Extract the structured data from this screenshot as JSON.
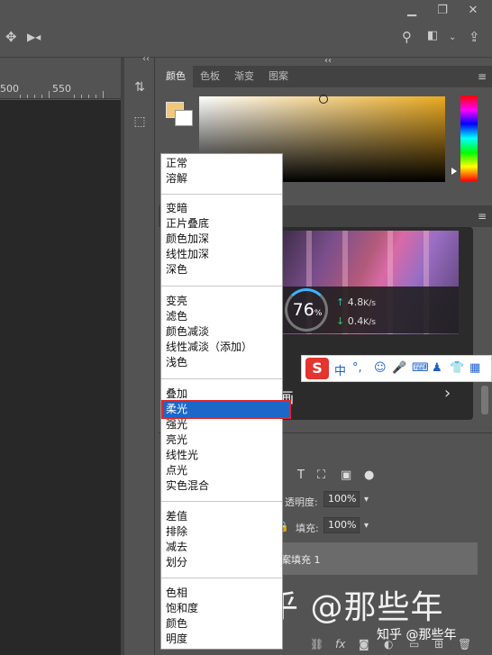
{
  "window": {
    "minimize_icon": "minimize-icon",
    "restore_icon": "restore-icon",
    "close_icon": "close-icon"
  },
  "ruler": {
    "labels": [
      "500",
      "550"
    ]
  },
  "panels": {
    "color_tabs": [
      "颜色",
      "色板",
      "渐变",
      "图案"
    ],
    "active_tab": "颜色",
    "foreground_color": "#f0c87a",
    "background_color": "#ffffff",
    "hue_color": "#ebab21"
  },
  "speed_widget": {
    "percent": "76",
    "percent_unit": "%",
    "upload": "4.8",
    "upload_unit": "K/s",
    "download": "0.4",
    "download_unit": "K/s"
  },
  "ime_toolbar": {
    "logo": "S",
    "mode": "中"
  },
  "card": {
    "title_fragment": "画"
  },
  "layers": {
    "opacity_label": "透明度:",
    "opacity_value": "100%",
    "fill_label": "填充:",
    "fill_value": "100%",
    "layer_name": "案填充 1",
    "fx_label": "fx"
  },
  "blend_menu": {
    "groups": [
      [
        "正常",
        "溶解"
      ],
      [
        "变暗",
        "正片叠底",
        "颜色加深",
        "线性加深",
        "深色"
      ],
      [
        "变亮",
        "滤色",
        "颜色减淡",
        "线性减淡（添加）",
        "浅色"
      ],
      [
        "叠加",
        "柔光",
        "强光",
        "亮光",
        "线性光",
        "点光",
        "实色混合"
      ],
      [
        "差值",
        "排除",
        "减去",
        "划分"
      ],
      [
        "色相",
        "饱和度",
        "颜色",
        "明度"
      ]
    ],
    "selected": "柔光"
  },
  "watermark": {
    "large": "知乎 @那些年",
    "small": "知乎 @那些年"
  }
}
